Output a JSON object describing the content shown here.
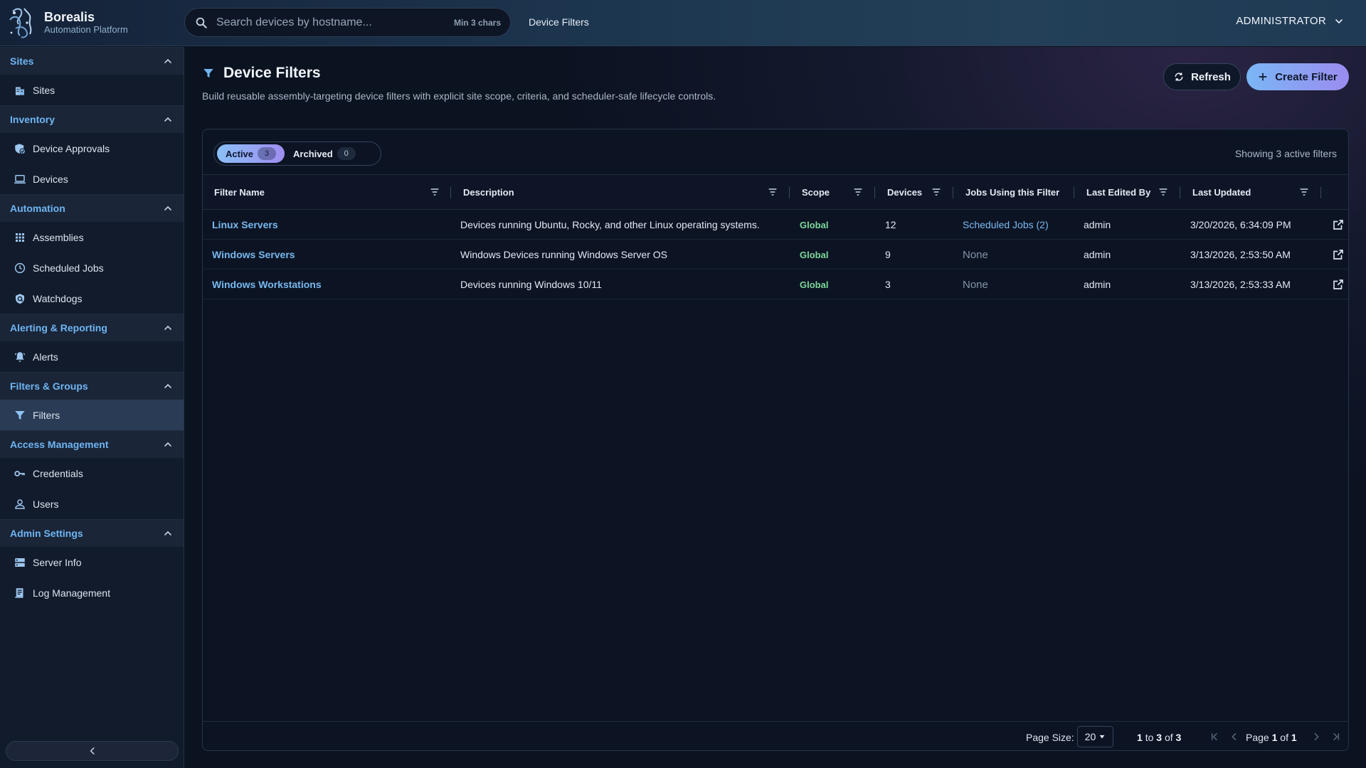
{
  "app": {
    "name": "Borealis",
    "subtitle": "Automation Platform"
  },
  "search": {
    "placeholder": "Search devices by hostname...",
    "hint": "Min 3 chars"
  },
  "breadcrumb": "Device Filters",
  "user": {
    "label": "ADMINISTRATOR"
  },
  "sidebar": {
    "sections": [
      {
        "label": "Sites",
        "items": [
          {
            "label": "Sites",
            "icon": "building-icon"
          }
        ]
      },
      {
        "label": "Inventory",
        "items": [
          {
            "label": "Device Approvals",
            "icon": "shield-check-icon"
          },
          {
            "label": "Devices",
            "icon": "laptop-icon"
          }
        ]
      },
      {
        "label": "Automation",
        "items": [
          {
            "label": "Assemblies",
            "icon": "grid-icon"
          },
          {
            "label": "Scheduled Jobs",
            "icon": "clock-icon"
          },
          {
            "label": "Watchdogs",
            "icon": "watchdog-icon"
          }
        ]
      },
      {
        "label": "Alerting & Reporting",
        "items": [
          {
            "label": "Alerts",
            "icon": "bell-icon"
          }
        ]
      },
      {
        "label": "Filters & Groups",
        "items": [
          {
            "label": "Filters",
            "icon": "filter-icon",
            "active": true
          }
        ]
      },
      {
        "label": "Access Management",
        "items": [
          {
            "label": "Credentials",
            "icon": "key-icon"
          },
          {
            "label": "Users",
            "icon": "user-icon"
          }
        ]
      },
      {
        "label": "Admin Settings",
        "items": [
          {
            "label": "Server Info",
            "icon": "server-icon"
          },
          {
            "label": "Log Management",
            "icon": "log-icon"
          }
        ]
      }
    ]
  },
  "page": {
    "title": "Device Filters",
    "subtitle": "Build reusable assembly-targeting device filters with explicit site scope, criteria, and scheduler-safe lifecycle controls.",
    "refresh_label": "Refresh",
    "create_label": "Create Filter"
  },
  "tabs": [
    {
      "label": "Active",
      "count": "3",
      "active": true
    },
    {
      "label": "Archived",
      "count": "0",
      "active": false
    }
  ],
  "showing": "Showing 3 active filters",
  "table": {
    "columns": [
      "Filter Name",
      "Description",
      "Scope",
      "Devices",
      "Jobs Using this Filter",
      "Last Edited By",
      "Last Updated"
    ],
    "rows": [
      {
        "name": "Linux Servers",
        "description": "Devices running Ubuntu, Rocky, and other Linux operating systems.",
        "scope": "Global",
        "devices": "12",
        "jobs": "Scheduled Jobs (2)",
        "jobs_link": true,
        "edited_by": "admin",
        "updated": "3/20/2026, 6:34:09 PM"
      },
      {
        "name": "Windows Servers",
        "description": "Windows Devices running Windows Server OS",
        "scope": "Global",
        "devices": "9",
        "jobs": "None",
        "jobs_link": false,
        "edited_by": "admin",
        "updated": "3/13/2026, 2:53:50 AM"
      },
      {
        "name": "Windows Workstations",
        "description": "Devices running Windows 10/11",
        "scope": "Global",
        "devices": "3",
        "jobs": "None",
        "jobs_link": false,
        "edited_by": "admin",
        "updated": "3/13/2026, 2:53:33 AM"
      }
    ]
  },
  "footer": {
    "page_size_label": "Page Size:",
    "page_size": "20",
    "range_from": "1",
    "range_to_word": "to",
    "range_to": "3",
    "range_of_word": "of",
    "range_total": "3",
    "page_word": "Page",
    "page_current": "1",
    "page_of_word": "of",
    "page_total": "1"
  },
  "colors": {
    "accent": "#78b8ee",
    "scope_global": "#7fd89a",
    "primary_gradient_start": "#7ab6f5",
    "primary_gradient_end": "#9b8cf0"
  }
}
